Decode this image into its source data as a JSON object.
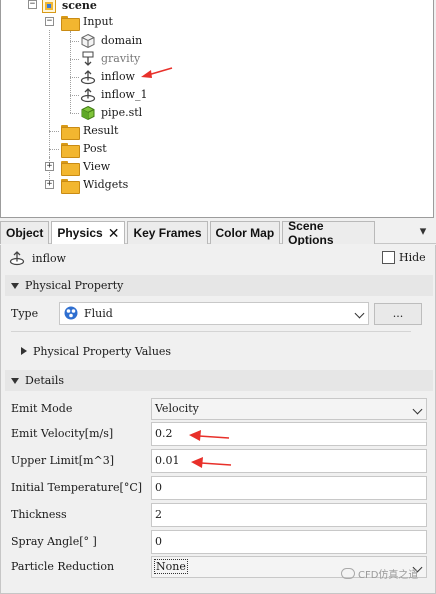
{
  "tree": {
    "root_label": "scene",
    "items": [
      {
        "label": "Input",
        "icon": "folder-icon"
      },
      {
        "label": "domain",
        "icon": "cube-outline-icon"
      },
      {
        "label": "gravity",
        "icon": "gravity-arrow-icon"
      },
      {
        "label": "inflow",
        "icon": "inflow-emitter-icon"
      },
      {
        "label": "inflow_1",
        "icon": "inflow-emitter-icon"
      },
      {
        "label": "pipe.stl",
        "icon": "green-cube-icon"
      },
      {
        "label": "Result",
        "icon": "folder-icon"
      },
      {
        "label": "Post",
        "icon": "folder-icon"
      },
      {
        "label": "View",
        "icon": "folder-icon"
      },
      {
        "label": "Widgets",
        "icon": "folder-icon"
      }
    ]
  },
  "tabs": [
    {
      "label": "Object",
      "active": false
    },
    {
      "label": "Physics",
      "active": true,
      "close": "✕"
    },
    {
      "label": "Key Frames",
      "active": false
    },
    {
      "label": "Color Map",
      "active": false
    },
    {
      "label": "Scene Options",
      "active": false
    }
  ],
  "tabs_menu": "▾",
  "header": {
    "object_name": "inflow",
    "hide_label": "Hide",
    "hide_checked": false
  },
  "physical_property": {
    "section_title": "Physical Property",
    "type_label": "Type",
    "type_value": "Fluid",
    "more_button": "...",
    "values_title": "Physical Property Values"
  },
  "details": {
    "section_title": "Details",
    "rows": [
      {
        "label": "Emit Mode",
        "value": "Velocity",
        "kind": "dropdown"
      },
      {
        "label": "Emit Velocity[m/s]",
        "value": "0.2",
        "kind": "input"
      },
      {
        "label": "Upper Limit[m^3]",
        "value": "0.01",
        "kind": "input"
      },
      {
        "label": "Initial Temperature[°C]",
        "value": "0",
        "kind": "input"
      },
      {
        "label": "Thickness",
        "value": "2",
        "kind": "input"
      },
      {
        "label": "Spray Angle[° ]",
        "value": "0",
        "kind": "input"
      },
      {
        "label": "Particle Reduction",
        "value": "None",
        "kind": "dropdown"
      }
    ]
  },
  "watermark": "CFD仿真之道",
  "colors": {
    "annotation_arrow": "#e8302a",
    "folder": "#f2b630",
    "tab_active": "#ffffff"
  }
}
